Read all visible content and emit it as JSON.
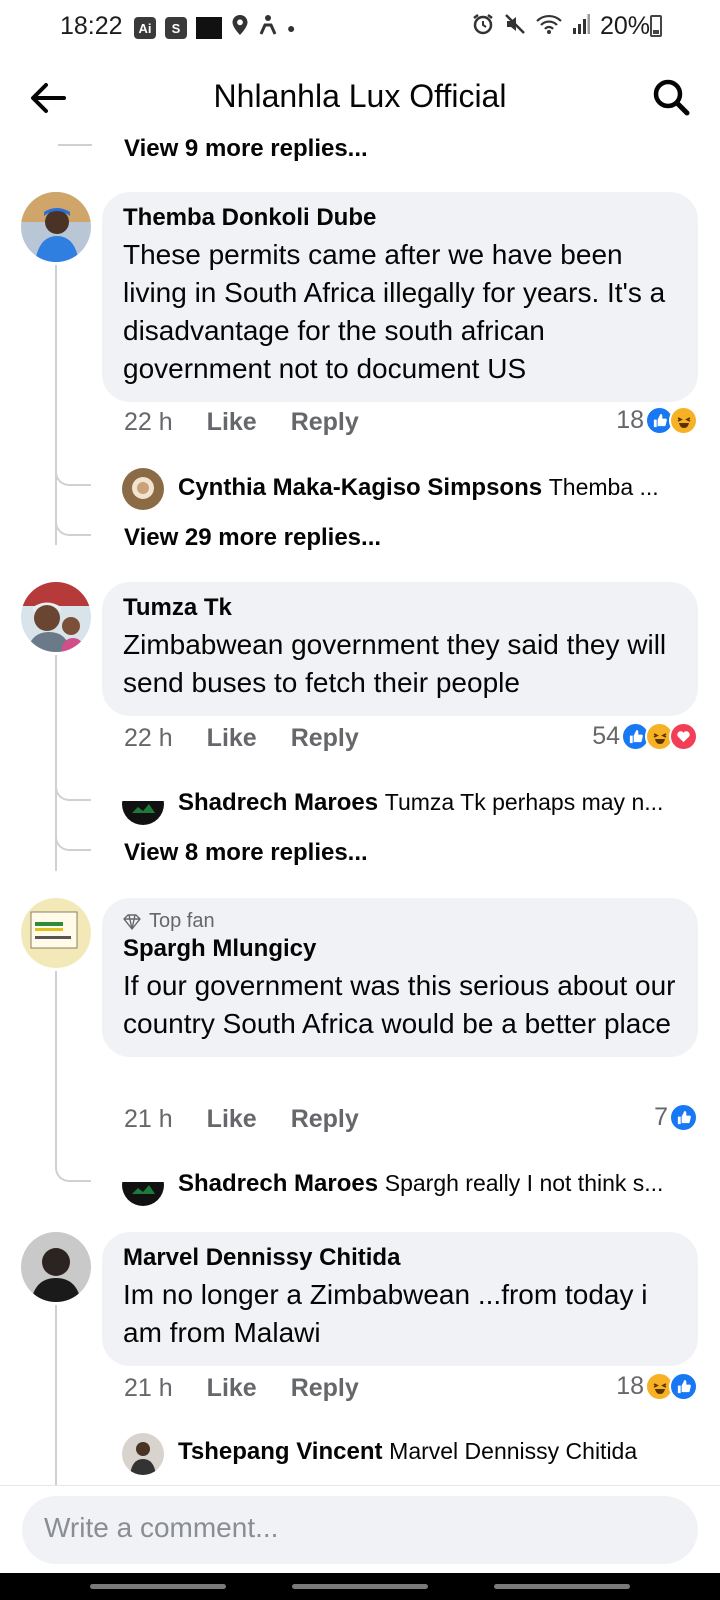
{
  "status_bar": {
    "time": "18:22",
    "icons_left": [
      "Ai",
      "S"
    ],
    "battery": "20%"
  },
  "header": {
    "title": "Nhlanhla Lux Official"
  },
  "thread": {
    "top_more_replies": "View 9 more replies...",
    "comments": [
      {
        "author": "Themba Donkoli Dube",
        "text": "These permits came after we have been living in South Africa illegally for years. It's a disadvantage for the south african government not to document US",
        "time": "22 h",
        "like": "Like",
        "reply": "Reply",
        "reaction_count": "18",
        "reactions": [
          "like",
          "haha"
        ],
        "reply_preview": {
          "author": "Cynthia Maka-Kagiso Simpsons",
          "text": "Themba ..."
        },
        "more_replies": "View 29 more replies..."
      },
      {
        "author": "Tumza Tk",
        "text": "Zimbabwean government they said they will send buses to fetch their people",
        "time": "22 h",
        "like": "Like",
        "reply": "Reply",
        "reaction_count": "54",
        "reactions": [
          "like",
          "haha",
          "love"
        ],
        "reply_preview": {
          "author": "Shadrech Maroes",
          "text": "Tumza Tk perhaps may n..."
        },
        "more_replies": "View 8 more replies..."
      },
      {
        "badge": "Top fan",
        "author": "Spargh Mlungicy",
        "text": "If our government was this serious about our country South Africa would be a better place",
        "time": "21 h",
        "like": "Like",
        "reply": "Reply",
        "reaction_count": "7",
        "reactions": [
          "like"
        ],
        "reply_preview": {
          "author": "Shadrech Maroes",
          "text": "Spargh really I not think s..."
        }
      },
      {
        "author": "Marvel Dennissy Chitida",
        "text": "Im no longer a Zimbabwean ...from today i am from Malawi",
        "time": "21 h",
        "like": "Like",
        "reply": "Reply",
        "reaction_count": "18",
        "reactions": [
          "haha",
          "like"
        ],
        "reply_preview": {
          "author": "Tshepang Vincent",
          "text": "Marvel Dennissy Chitida"
        }
      }
    ]
  },
  "composer": {
    "placeholder": "Write a comment..."
  }
}
